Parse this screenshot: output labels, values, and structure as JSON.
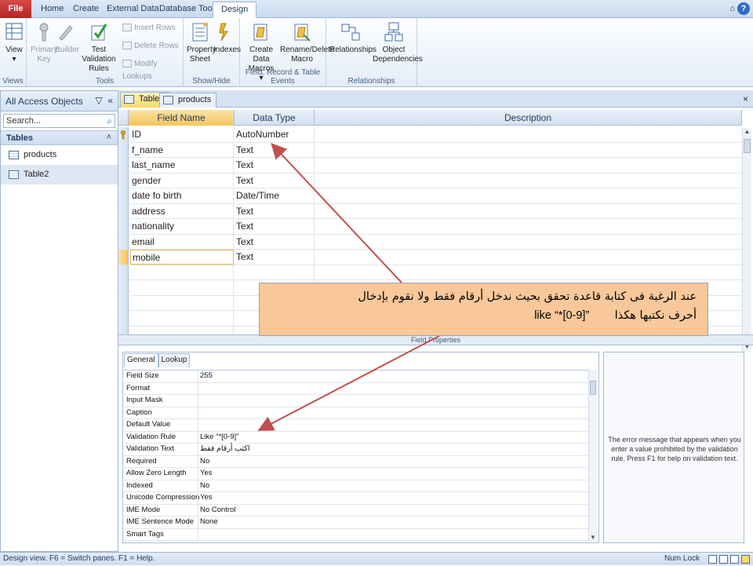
{
  "ribbon": {
    "tabs": [
      {
        "label": "File",
        "active": false
      },
      {
        "label": "Home",
        "active": false
      },
      {
        "label": "Create",
        "active": false
      },
      {
        "label": "External Data",
        "active": false
      },
      {
        "label": "Database Tools",
        "active": false
      },
      {
        "label": "Design",
        "active": true
      }
    ],
    "groups": {
      "views": {
        "label": "Views",
        "view_btn": "View"
      },
      "tools": {
        "label": "Tools",
        "primary_key": "Primary Key",
        "builder": "Builder",
        "test_validation": "Test Validation Rules",
        "insert_rows": "Insert Rows",
        "delete_rows": "Delete Rows",
        "modify_lookups": "Modify Lookups"
      },
      "showhide": {
        "label": "Show/Hide",
        "property_sheet": "Property Sheet",
        "indexes": "Indexes"
      },
      "events": {
        "label": "Field, Record & Table Events",
        "create_data_macros": "Create Data Macros",
        "rename_delete_macro": "Rename/Delete Macro"
      },
      "relationships": {
        "label": "Relationships",
        "relationships_btn": "Relationships",
        "object_dependencies": "Object Dependencies"
      }
    }
  },
  "nav": {
    "title": "All Access Objects",
    "search_placeholder": "Search...",
    "section": "Tables",
    "items": [
      "products",
      "Table2"
    ]
  },
  "doc": {
    "tabs": [
      {
        "label": "Table2",
        "active": true
      },
      {
        "label": "products",
        "active": false
      }
    ],
    "grid": {
      "headers": {
        "field": "Field Name",
        "type": "Data Type",
        "desc": "Description"
      },
      "rows": [
        {
          "field": "ID",
          "type": "AutoNumber",
          "key": true
        },
        {
          "field": "f_name",
          "type": "Text"
        },
        {
          "field": "last_name",
          "type": "Text"
        },
        {
          "field": "gender",
          "type": "Text"
        },
        {
          "field": "date fo birth",
          "type": "Date/Time"
        },
        {
          "field": "address",
          "type": "Text"
        },
        {
          "field": "nationality",
          "type": "Text"
        },
        {
          "field": "email",
          "type": "Text"
        },
        {
          "field": "mobile",
          "type": "Text",
          "current": true
        }
      ]
    },
    "field_properties_label": "Field Properties",
    "props_tabs": [
      "General",
      "Lookup"
    ],
    "properties": [
      {
        "name": "Field Size",
        "value": "255"
      },
      {
        "name": "Format",
        "value": ""
      },
      {
        "name": "Input Mask",
        "value": ""
      },
      {
        "name": "Caption",
        "value": ""
      },
      {
        "name": "Default Value",
        "value": ""
      },
      {
        "name": "Validation Rule",
        "value": "Like \"*[0-9]\""
      },
      {
        "name": "Validation Text",
        "value": "اكتب أرقام فقط"
      },
      {
        "name": "Required",
        "value": "No"
      },
      {
        "name": "Allow Zero Length",
        "value": "Yes"
      },
      {
        "name": "Indexed",
        "value": "No"
      },
      {
        "name": "Unicode Compression",
        "value": "Yes"
      },
      {
        "name": "IME Mode",
        "value": "No Control"
      },
      {
        "name": "IME Sentence Mode",
        "value": "None"
      },
      {
        "name": "Smart Tags",
        "value": ""
      }
    ],
    "help_text": "The error message that appears when you enter a value prohibited by the validation rule. Press F1 for help on validation text."
  },
  "callout": {
    "line1": "عند الرغبة فى كتابة قاعدة تحقق بحيث ندخل أرقام فقط ولا نقوم بإدخال",
    "line2_ar": "أحرف نكتبها هكذا",
    "line2_code": "like “*[0-9]”"
  },
  "status": {
    "left": "Design view.  F6 = Switch panes.  F1 = Help.",
    "numlock": "Num Lock"
  },
  "colors": {
    "file_tab": "#c0392b",
    "callout_bg": "#f9c89a",
    "arrow": "#c0504d",
    "current_row": "#f4c55b"
  }
}
